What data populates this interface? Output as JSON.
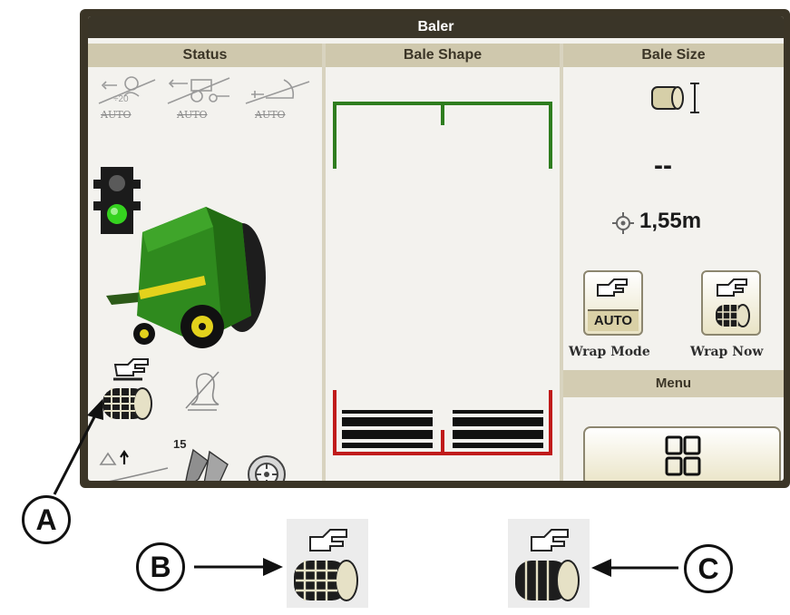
{
  "window": {
    "title": "Baler"
  },
  "status_panel": {
    "header": "Status",
    "auto_functions": [
      {
        "icon": "tractor-speed-icon",
        "label": "AUTO"
      },
      {
        "icon": "tractor-steer-icon",
        "label": "AUTO"
      },
      {
        "icon": "pickup-auto-icon",
        "label": "AUTO"
      }
    ],
    "traffic_light": {
      "icon": "traffic-light-icon",
      "state": "green"
    },
    "pickup_speed": "15"
  },
  "shape_panel": {
    "header": "Bale Shape"
  },
  "size_panel": {
    "header": "Bale Size",
    "bale_count": "--",
    "bale_diameter": "1,55m",
    "wrap_mode": {
      "badge": "AUTO",
      "label": "Wrap Mode"
    },
    "wrap_now": {
      "label": "Wrap Now"
    }
  },
  "menu": {
    "header": "Menu"
  },
  "callouts": [
    {
      "letter": "A"
    },
    {
      "letter": "B"
    },
    {
      "letter": "C"
    }
  ],
  "colors": {
    "title_bar": "#3a3528",
    "frame_green": "#2e7d1e",
    "frame_red": "#c01b1b",
    "baler_green": "#2f8a1e",
    "baler_yellow": "#e3d21c"
  }
}
